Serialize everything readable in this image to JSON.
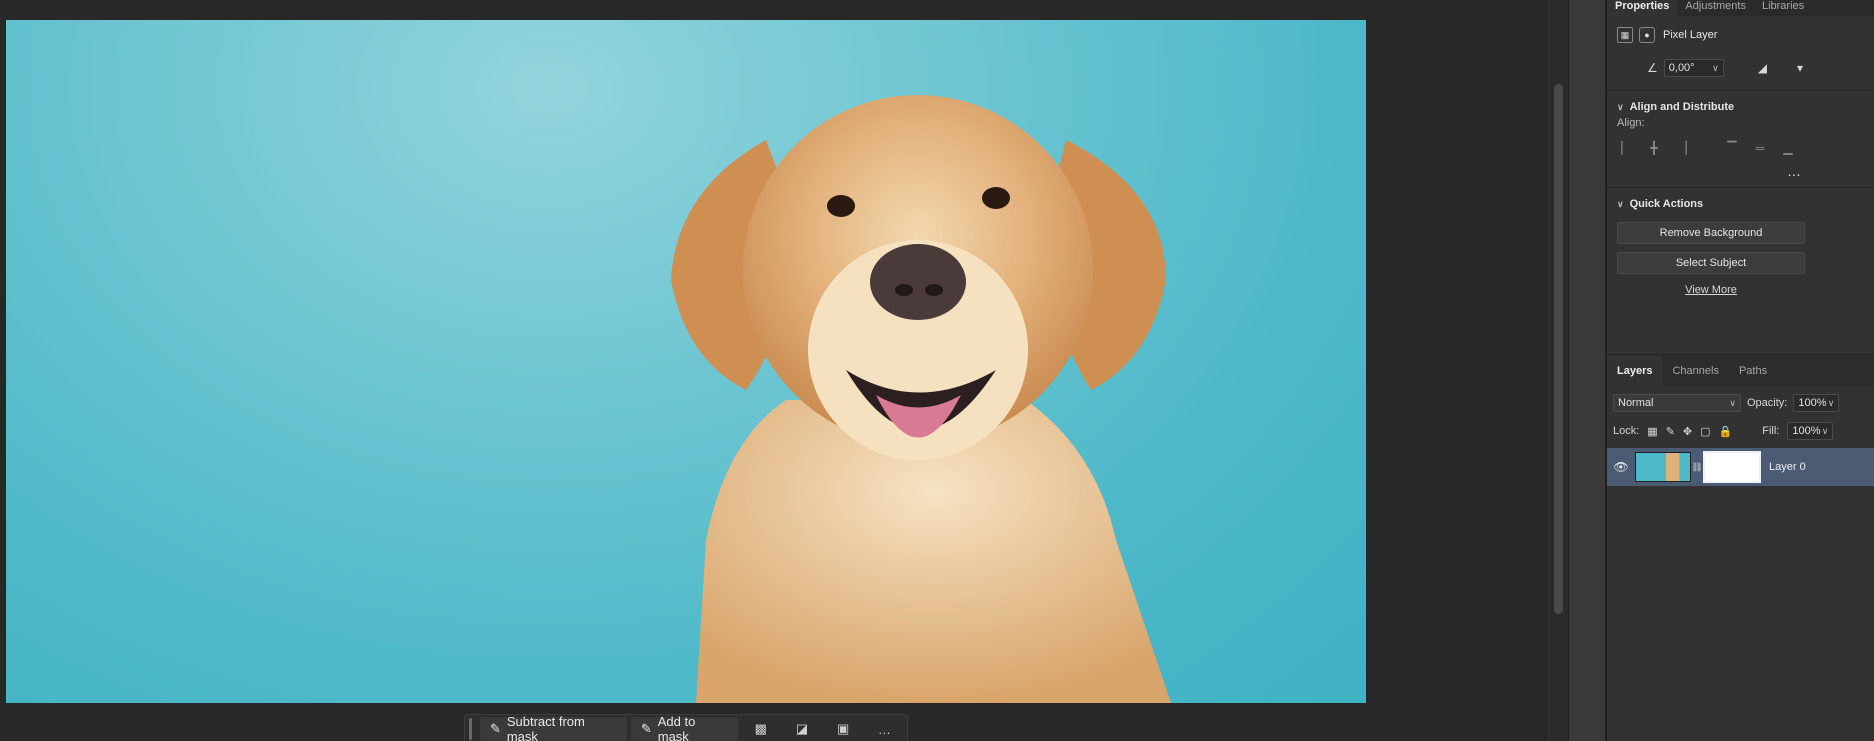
{
  "taskbar": {
    "subtract_label": "Subtract from mask",
    "add_label": "Add to mask",
    "more": "…"
  },
  "properties": {
    "tabs": [
      "Properties",
      "Adjustments",
      "Libraries"
    ],
    "layer_kind": "Pixel Layer",
    "angle_value": "0,00°",
    "align_section": "Align and Distribute",
    "align_label": "Align:",
    "more": "…",
    "quick_actions_section": "Quick Actions",
    "remove_background": "Remove Background",
    "select_subject": "Select Subject",
    "view_more": "View More"
  },
  "layers": {
    "tabs": [
      "Layers",
      "Channels",
      "Paths"
    ],
    "blend_mode": "Normal",
    "opacity_label": "Opacity:",
    "opacity_value": "100%",
    "lock_label": "Lock:",
    "fill_label": "Fill:",
    "fill_value": "100%",
    "layer_name": "Layer 0"
  },
  "colors": {
    "background": "#282828",
    "panel": "#323232",
    "selected_layer": "#4a5b73",
    "canvas_teal": "#4db8c8"
  }
}
